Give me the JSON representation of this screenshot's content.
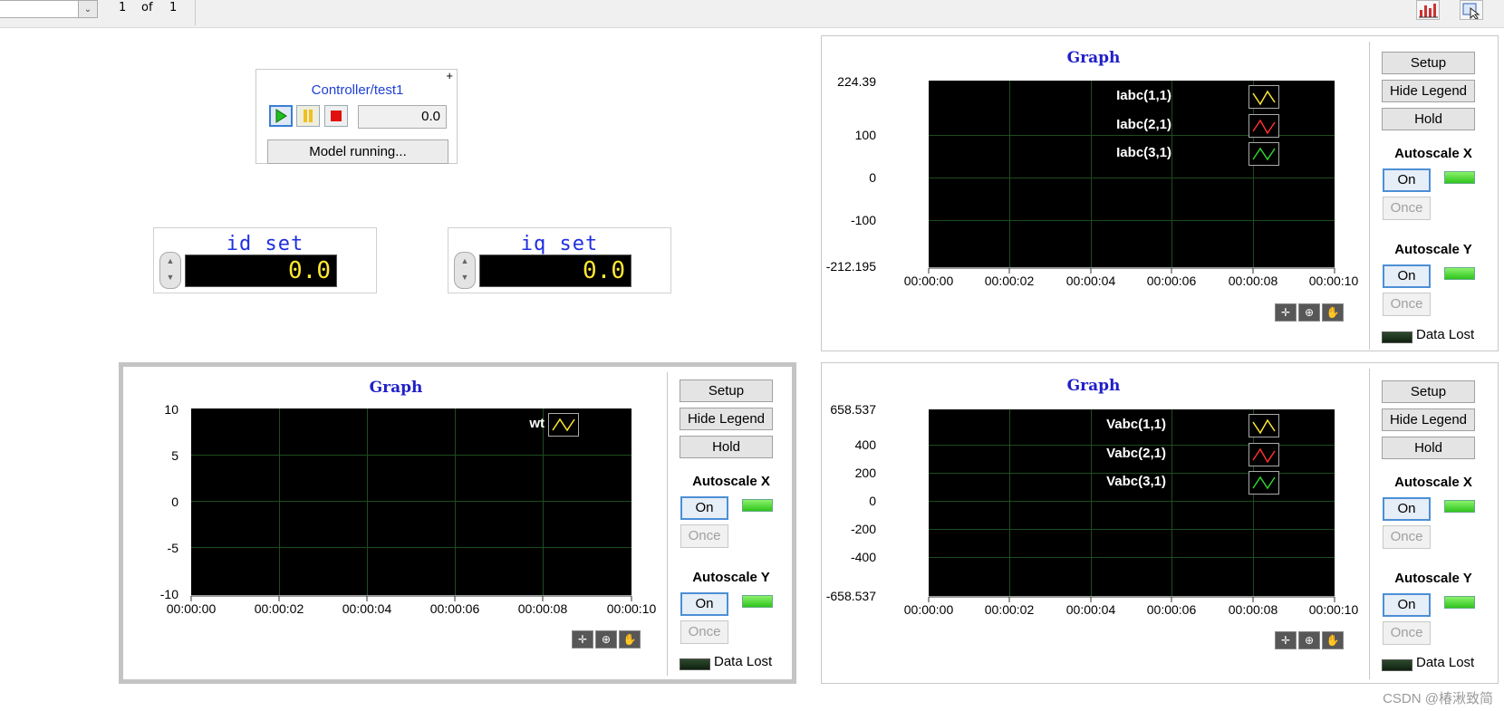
{
  "toolbar": {
    "page_current": "1",
    "page_of": "of",
    "page_total": "1",
    "icons": [
      "chart-icon",
      "cursor-icon"
    ]
  },
  "controller": {
    "title": "Controller/test1",
    "plus": "+",
    "time_value": "0.0",
    "status": "Model running..."
  },
  "id_set": {
    "label": "id set",
    "value": "0.0"
  },
  "iq_set": {
    "label": "iq set",
    "value": "0.0"
  },
  "graph_iabc": {
    "title": "Graph",
    "y_ticks": [
      "224.39",
      "100",
      "0",
      "-100",
      "-212.195"
    ],
    "x_ticks": [
      "00:00:00",
      "00:00:02",
      "00:00:04",
      "00:00:06",
      "00:00:08",
      "00:00:10"
    ],
    "legend": [
      "Iabc(1,1)",
      "Iabc(2,1)",
      "Iabc(3,1)"
    ],
    "buttons": {
      "setup": "Setup",
      "hide_legend": "Hide Legend",
      "hold": "Hold"
    },
    "autoscale_x": "Autoscale X",
    "autoscale_y": "Autoscale Y",
    "on": "On",
    "once": "Once",
    "data_lost": "Data Lost"
  },
  "graph_wt": {
    "title": "Graph",
    "y_ticks": [
      "10",
      "5",
      "0",
      "-5",
      "-10"
    ],
    "x_ticks": [
      "00:00:00",
      "00:00:02",
      "00:00:04",
      "00:00:06",
      "00:00:08",
      "00:00:10"
    ],
    "legend": [
      "wt"
    ],
    "buttons": {
      "setup": "Setup",
      "hide_legend": "Hide Legend",
      "hold": "Hold"
    },
    "autoscale_x": "Autoscale X",
    "autoscale_y": "Autoscale Y",
    "on": "On",
    "once": "Once",
    "data_lost": "Data Lost"
  },
  "graph_vabc": {
    "title": "Graph",
    "y_ticks": [
      "658.537",
      "400",
      "200",
      "0",
      "-200",
      "-400",
      "-658.537"
    ],
    "x_ticks": [
      "00:00:00",
      "00:00:02",
      "00:00:04",
      "00:00:06",
      "00:00:08",
      "00:00:10"
    ],
    "legend": [
      "Vabc(1,1)",
      "Vabc(2,1)",
      "Vabc(3,1)"
    ],
    "buttons": {
      "setup": "Setup",
      "hide_legend": "Hide Legend",
      "hold": "Hold"
    },
    "autoscale_x": "Autoscale X",
    "autoscale_y": "Autoscale Y",
    "on": "On",
    "once": "Once",
    "data_lost": "Data Lost"
  },
  "colors": {
    "legend_1": "#ffe832",
    "legend_2": "#ff3030",
    "legend_3": "#2fd02f",
    "title_blue": "#2020c8",
    "display_yellow": "#ffe832"
  },
  "watermark": "CSDN @椿湫致简"
}
